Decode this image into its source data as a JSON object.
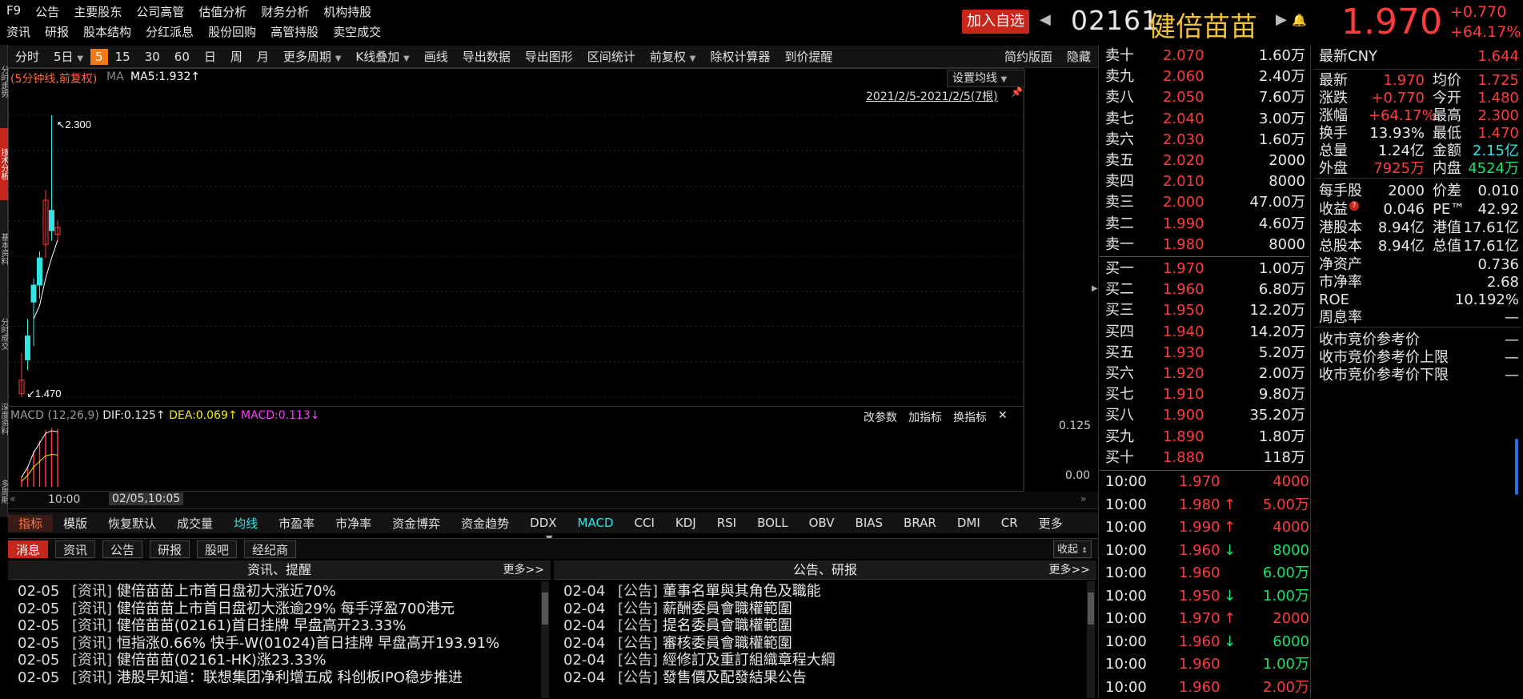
{
  "nav": {
    "row1": [
      "F9",
      "公告",
      "主要股东",
      "公司高管",
      "估值分析",
      "财务分析",
      "机构持股"
    ],
    "row2": [
      "资讯",
      "研报",
      "股本结构",
      "分红派息",
      "股份回购",
      "高管持股",
      "卖空成交"
    ]
  },
  "header": {
    "add_watch": "加入自选",
    "code": "02161",
    "name": "健倍苗苗",
    "price": "1.970",
    "change": "+0.770",
    "change_pct": "+64.17%"
  },
  "vstrip": [
    "分时走势",
    "技术分析",
    "基本资料",
    "分时成交",
    "深度资料",
    "多周期"
  ],
  "toolbar": {
    "items": [
      "分时",
      "5日",
      "5",
      "15",
      "30",
      "60",
      "日",
      "周",
      "月",
      "更多周期",
      "K线叠加",
      "画线",
      "导出数据",
      "导出图形",
      "区间统计",
      "前复权",
      "除权计算器",
      "到价提醒",
      "简约版面",
      "隐藏"
    ]
  },
  "chart": {
    "info_left": "(5分钟线,前复权)",
    "ma_label": "MA",
    "ma_value": "MA5:1.932↑",
    "set_ma": "设置均线",
    "date_range": "2021/2/5-2021/2/5(7根)",
    "high_label": "2.300",
    "low_label": "1.470",
    "yticks": [
      "2.300",
      "2.196",
      "2.092",
      "1.989",
      "1.885",
      "1.781",
      "1.678",
      "1.574",
      "1.470"
    ]
  },
  "chart_data": {
    "type": "candlestick",
    "title": "",
    "xlabel": "",
    "ylabel": "",
    "ylim": [
      1.47,
      2.3
    ],
    "y_ticks": [
      2.3,
      2.196,
      2.092,
      1.989,
      1.885,
      1.781,
      1.678,
      1.574,
      1.47
    ],
    "candles": [
      {
        "open": 1.48,
        "close": 1.52,
        "high": 1.6,
        "low": 1.47
      },
      {
        "open": 1.65,
        "close": 1.58,
        "high": 1.7,
        "low": 1.55
      },
      {
        "open": 1.8,
        "close": 1.75,
        "high": 1.82,
        "low": 1.62
      },
      {
        "open": 1.88,
        "close": 1.8,
        "high": 1.9,
        "low": 1.76
      },
      {
        "open": 1.92,
        "close": 2.05,
        "high": 2.08,
        "low": 1.88
      },
      {
        "open": 2.02,
        "close": 1.96,
        "high": 2.3,
        "low": 1.93
      },
      {
        "open": 1.95,
        "close": 1.97,
        "high": 1.99,
        "low": 1.93
      }
    ],
    "ma5": [
      1.7,
      1.74,
      1.82,
      1.88,
      1.932
    ],
    "macd": {
      "name": "MACD (12,26,9)",
      "dif": "DIF:0.125↑",
      "dea": "DEA:0.069↑",
      "macd": "MACD:0.113↓",
      "ylim": [
        0.0,
        0.125
      ],
      "y_ticks": [
        "0.125",
        "0.00"
      ],
      "bars": [
        0.02,
        0.04,
        0.07,
        0.09,
        0.11,
        0.115,
        0.113
      ]
    }
  },
  "macd_panel": {
    "buttons": [
      "改参数",
      "加指标",
      "换指标"
    ]
  },
  "timeaxis": {
    "t1": "10:00",
    "t2": "02/05,10:05"
  },
  "indicator_tabs": [
    "指标",
    "模版",
    "恢复默认",
    "成交量",
    "均线",
    "市盈率",
    "市净率",
    "资金博弈",
    "资金趋势",
    "DDX",
    "MACD",
    "CCI",
    "KDJ",
    "RSI",
    "BOLL",
    "OBV",
    "BIAS",
    "BRAR",
    "DMI",
    "CR",
    "更多"
  ],
  "news_tabs": [
    "消息",
    "资讯",
    "公告",
    "研报",
    "股吧",
    "经纪商"
  ],
  "collapse_label": "收起",
  "news_left": {
    "title": "资讯、提醒",
    "more": "更多>>",
    "items": [
      {
        "date": "02-05",
        "tag": "[资讯]",
        "text": "健倍苗苗上市首日盘初大涨近70%"
      },
      {
        "date": "02-05",
        "tag": "[资讯]",
        "text": "健倍苗苗上市首日盘初大涨逾29% 每手浮盈700港元"
      },
      {
        "date": "02-05",
        "tag": "[资讯]",
        "text": "健倍苗苗(02161)首日挂牌 早盘高开23.33%"
      },
      {
        "date": "02-05",
        "tag": "[资讯]",
        "text": "恒指涨0.66% 快手-W(01024)首日挂牌 早盘高开193.91%"
      },
      {
        "date": "02-05",
        "tag": "[资讯]",
        "text": "健倍苗苗(02161-HK)涨23.33%"
      },
      {
        "date": "02-05",
        "tag": "[资讯]",
        "text": "港股早知道：联想集团净利增五成 科创板IPO稳步推进"
      }
    ]
  },
  "news_right": {
    "title": "公告、研报",
    "more": "更多>>",
    "items": [
      {
        "date": "02-04",
        "tag": "[公告]",
        "text": "董事名單與其角色及職能"
      },
      {
        "date": "02-04",
        "tag": "[公告]",
        "text": "薪酬委員會職權範圍"
      },
      {
        "date": "02-04",
        "tag": "[公告]",
        "text": "提名委員會職權範圍"
      },
      {
        "date": "02-04",
        "tag": "[公告]",
        "text": "審核委員會職權範圍"
      },
      {
        "date": "02-04",
        "tag": "[公告]",
        "text": "經修訂及重訂組織章程大綱"
      },
      {
        "date": "02-04",
        "tag": "[公告]",
        "text": "發售價及配發結果公告"
      }
    ]
  },
  "orderbook": {
    "asks": [
      {
        "label": "卖十",
        "price": "2.070",
        "vol": "1.60万"
      },
      {
        "label": "卖九",
        "price": "2.060",
        "vol": "2.40万"
      },
      {
        "label": "卖八",
        "price": "2.050",
        "vol": "7.60万"
      },
      {
        "label": "卖七",
        "price": "2.040",
        "vol": "3.00万"
      },
      {
        "label": "卖六",
        "price": "2.030",
        "vol": "1.60万"
      },
      {
        "label": "卖五",
        "price": "2.020",
        "vol": "2000"
      },
      {
        "label": "卖四",
        "price": "2.010",
        "vol": "8000"
      },
      {
        "label": "卖三",
        "price": "2.000",
        "vol": "47.00万"
      },
      {
        "label": "卖二",
        "price": "1.990",
        "vol": "4.60万"
      },
      {
        "label": "卖一",
        "price": "1.980",
        "vol": "8000"
      }
    ],
    "bids": [
      {
        "label": "买一",
        "price": "1.970",
        "vol": "1.00万"
      },
      {
        "label": "买二",
        "price": "1.960",
        "vol": "6.80万"
      },
      {
        "label": "买三",
        "price": "1.950",
        "vol": "12.20万"
      },
      {
        "label": "买四",
        "price": "1.940",
        "vol": "14.20万"
      },
      {
        "label": "买五",
        "price": "1.930",
        "vol": "5.20万"
      },
      {
        "label": "买六",
        "price": "1.920",
        "vol": "2.00万"
      },
      {
        "label": "买七",
        "price": "1.910",
        "vol": "9.80万"
      },
      {
        "label": "买八",
        "price": "1.900",
        "vol": "35.20万"
      },
      {
        "label": "买九",
        "price": "1.890",
        "vol": "1.80万"
      },
      {
        "label": "买十",
        "price": "1.880",
        "vol": "118万"
      }
    ]
  },
  "trades": [
    {
      "time": "10:00",
      "price": "1.970",
      "arrow": "",
      "vol": "4000",
      "dir": "none"
    },
    {
      "time": "10:00",
      "price": "1.980",
      "arrow": "↑",
      "vol": "5.00万",
      "dir": "up"
    },
    {
      "time": "10:00",
      "price": "1.990",
      "arrow": "↑",
      "vol": "4000",
      "dir": "up"
    },
    {
      "time": "10:00",
      "price": "1.960",
      "arrow": "↓",
      "vol": "8000",
      "dir": "down"
    },
    {
      "time": "10:00",
      "price": "1.960",
      "arrow": "",
      "vol": "6.00万",
      "dir": "down"
    },
    {
      "time": "10:00",
      "price": "1.950",
      "arrow": "↓",
      "vol": "1.00万",
      "dir": "down"
    },
    {
      "time": "10:00",
      "price": "1.970",
      "arrow": "↑",
      "vol": "2000",
      "dir": "up"
    },
    {
      "time": "10:00",
      "price": "1.960",
      "arrow": "↓",
      "vol": "6000",
      "dir": "down"
    },
    {
      "time": "10:00",
      "price": "1.960",
      "arrow": "",
      "vol": "1.00万",
      "dir": "down"
    },
    {
      "time": "10:00",
      "price": "1.960",
      "arrow": "",
      "vol": "2.00万",
      "dir": "up"
    }
  ],
  "stats": {
    "latest_cny_label": "最新CNY",
    "latest_cny": "1.644",
    "rows": [
      {
        "k": "最新",
        "v1": "1.970",
        "c1": "red",
        "k2": "均价",
        "v2": "1.725",
        "c2": "red"
      },
      {
        "k": "涨跌",
        "v1": "+0.770",
        "c1": "red",
        "k2": "今开",
        "v2": "1.480",
        "c2": "red"
      },
      {
        "k": "涨幅",
        "v1": "+64.17%",
        "c1": "red",
        "k2": "最高",
        "v2": "2.300",
        "c2": "red"
      },
      {
        "k": "换手",
        "v1": "13.93%",
        "c1": "wht",
        "k2": "最低",
        "v2": "1.470",
        "c2": "red"
      },
      {
        "k": "总量",
        "v1": "1.24亿",
        "c1": "wht",
        "k2": "金额",
        "v2": "2.15亿",
        "c2": "cyan"
      },
      {
        "k": "外盘",
        "v1": "7925万",
        "c1": "red",
        "k2": "内盘",
        "v2": "4524万",
        "c2": "grn"
      }
    ],
    "rows2": [
      {
        "k": "每手股",
        "v1": "2000",
        "k2": "价差",
        "v2": "0.010"
      },
      {
        "k": "收益",
        "v1": "0.046",
        "k2": "PE™",
        "v2": "42.92"
      },
      {
        "k": "港股本",
        "v1": "8.94亿",
        "k2": "港值",
        "v2": "17.61亿"
      },
      {
        "k": "总股本",
        "v1": "8.94亿",
        "k2": "总值",
        "v2": "17.61亿"
      }
    ],
    "single": [
      {
        "k": "净资产",
        "v": "0.736"
      },
      {
        "k": "市净率",
        "v": "2.68"
      },
      {
        "k": "ROE",
        "v": "10.192%"
      },
      {
        "k": "周息率",
        "v": "—"
      }
    ],
    "auction": [
      {
        "k": "收市竞价参考价",
        "v": "—"
      },
      {
        "k": "收市竞价参考价上限",
        "v": "—"
      },
      {
        "k": "收市竞价参考价下限",
        "v": "—"
      }
    ],
    "eps_badge": "?"
  }
}
